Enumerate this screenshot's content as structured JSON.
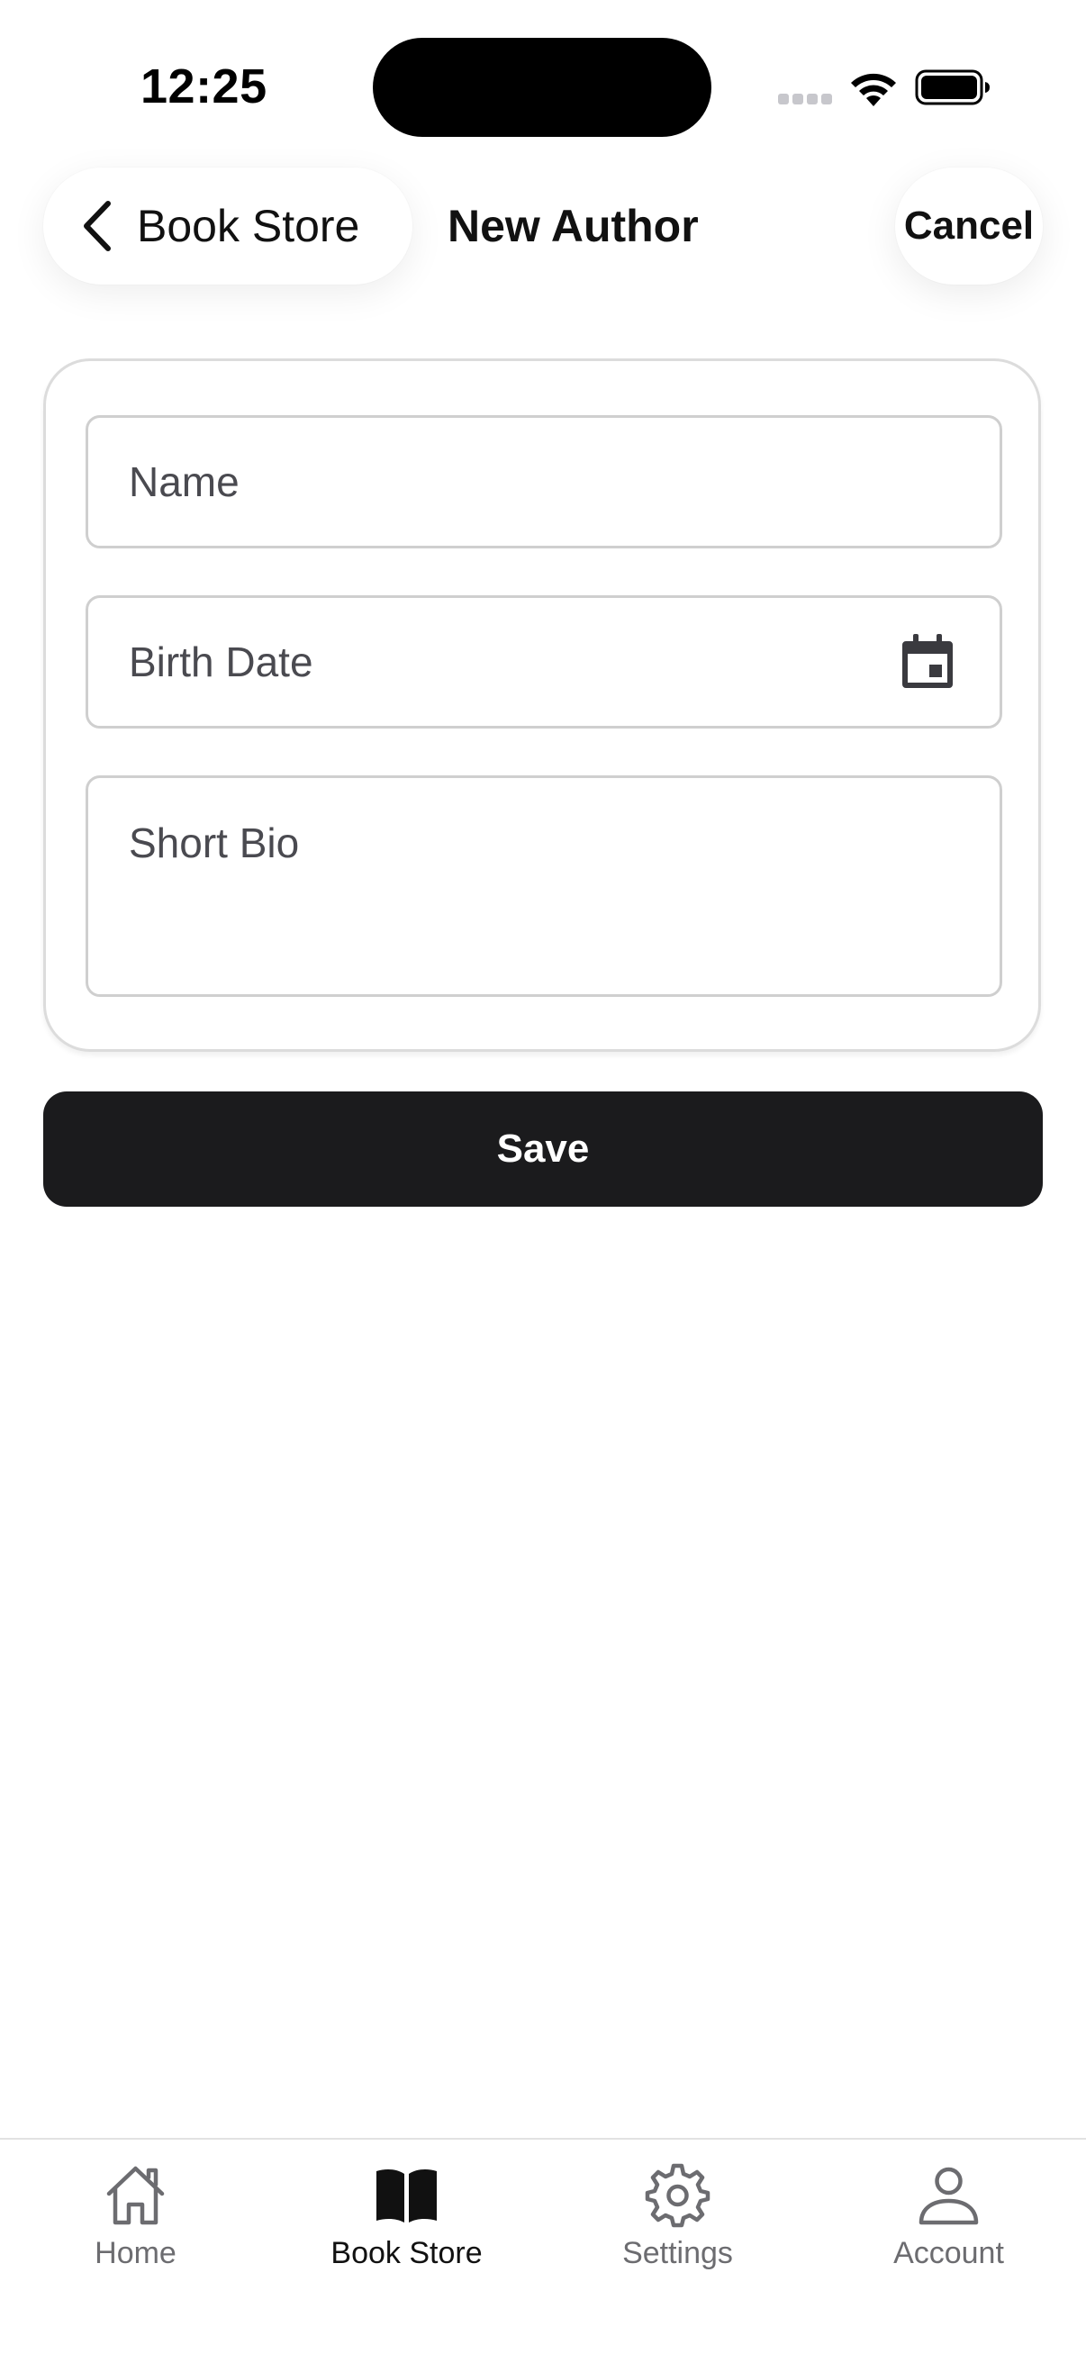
{
  "status_bar": {
    "time": "12:25"
  },
  "header": {
    "back_label": "Book Store",
    "title": "New Author",
    "cancel_label": "Cancel"
  },
  "form": {
    "name_placeholder": "Name",
    "birth_date_placeholder": "Birth Date",
    "bio_placeholder": "Short Bio"
  },
  "save_label": "Save",
  "tabs": [
    {
      "label": "Home",
      "icon": "house-icon",
      "active": false
    },
    {
      "label": "Book Store",
      "icon": "book-icon",
      "active": true
    },
    {
      "label": "Settings",
      "icon": "gear-icon",
      "active": false
    },
    {
      "label": "Account",
      "icon": "person-icon",
      "active": false
    }
  ],
  "colors": {
    "primary_button": "#1b1b1d",
    "active_tab": "#111111",
    "inactive_tab": "#6c6c70"
  }
}
